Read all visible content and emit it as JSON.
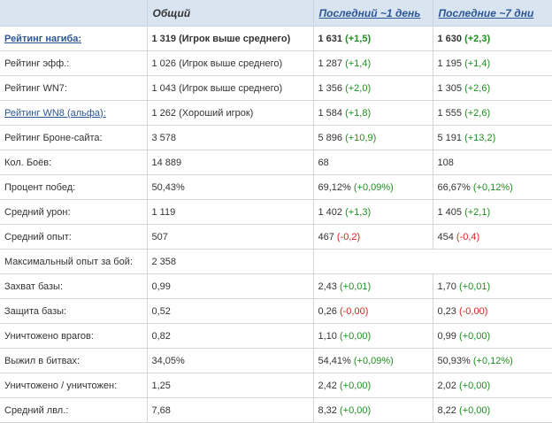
{
  "header": {
    "c2": "Общий",
    "c3": "Последний ~1 день",
    "c4": "Последние ~7 дни"
  },
  "rows": [
    {
      "label": "Рейтинг нагиба:",
      "c2": "1 319 (Игрок выше среднего)",
      "c3": "1 631",
      "c3d": "(+1,5)",
      "c4": "1 630",
      "c4d": "(+2,3)"
    },
    {
      "label": "Рейтинг эфф.:",
      "c2": "1 026 (Игрок выше среднего)",
      "c3": "1 287",
      "c3d": "(+1,4)",
      "c4": "1 195",
      "c4d": "(+1,4)"
    },
    {
      "label": "Рейтинг WN7:",
      "c2": "1 043 (Игрок выше среднего)",
      "c3": "1 356",
      "c3d": "(+2,0)",
      "c4": "1 305",
      "c4d": "(+2,6)"
    },
    {
      "label": "Рейтинг WN8 (альфа):",
      "c2": "1 262 (Хороший игрок)",
      "c3": "1 584",
      "c3d": "(+1,8)",
      "c4": "1 555",
      "c4d": "(+2,6)"
    },
    {
      "label": "Рейтинг Броне-сайта:",
      "c2": "3 578",
      "c3": "5 896",
      "c3d": "(+10,9)",
      "c4": "5 191",
      "c4d": "(+13,2)"
    },
    {
      "label": "Кол. Боёв:",
      "c2": "14 889",
      "c3": "68",
      "c3d": "",
      "c4": "108",
      "c4d": ""
    },
    {
      "label": "Процент побед:",
      "c2": "50,43%",
      "c3": "69,12%",
      "c3d": "(+0,09%)",
      "c4": "66,67%",
      "c4d": "(+0,12%)"
    },
    {
      "label": "Средний урон:",
      "c2": "1 119",
      "c3": "1 402",
      "c3d": "(+1,3)",
      "c4": "1 405",
      "c4d": "(+2,1)"
    },
    {
      "label": "Средний опыт:",
      "c2": "507",
      "c3": "467",
      "c3d": "(-0,2)",
      "c4": "454",
      "c4d": "(-0,4)"
    },
    {
      "label": "Максимальный опыт за бой:",
      "c2": "2 358",
      "c3": "",
      "c3d": "",
      "c4": "",
      "c4d": ""
    },
    {
      "label": "Захват базы:",
      "c2": "0,99",
      "c3": "2,43",
      "c3d": "(+0,01)",
      "c4": "1,70",
      "c4d": "(+0,01)"
    },
    {
      "label": "Защита базы:",
      "c2": "0,52",
      "c3": "0,26",
      "c3d": "(-0,00)",
      "c4": "0,23",
      "c4d": "(-0,00)"
    },
    {
      "label": "Уничтожено врагов:",
      "c2": "0,82",
      "c3": "1,10",
      "c3d": "(+0,00)",
      "c4": "0,99",
      "c4d": "(+0,00)"
    },
    {
      "label": "Выжил в битвах:",
      "c2": "34,05%",
      "c3": "54,41%",
      "c3d": "(+0,09%)",
      "c4": "50,93%",
      "c4d": "(+0,12%)"
    },
    {
      "label": "Уничтожено / уничтожен:",
      "c2": "1,25",
      "c3": "2,42",
      "c3d": "(+0,00)",
      "c4": "2,02",
      "c4d": "(+0,00)"
    },
    {
      "label": "Средний лвл.:",
      "c2": "7,68",
      "c3": "8,32",
      "c3d": "(+0,00)",
      "c4": "8,22",
      "c4d": "(+0,00)"
    }
  ],
  "colors": {
    "positive": "#1f8f1f",
    "negative": "#d2261e",
    "link": "#2b5797",
    "header_bg": "#d9e4f1"
  }
}
